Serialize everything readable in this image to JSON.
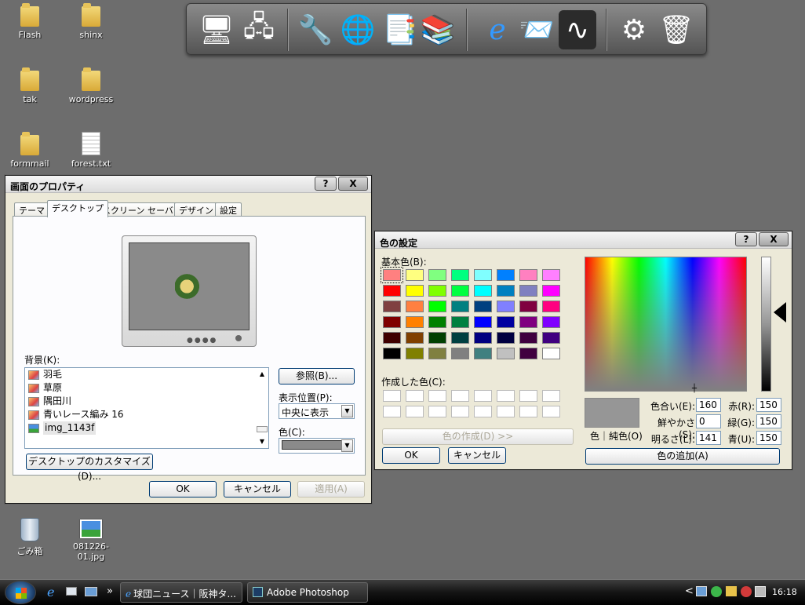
{
  "desktop": {
    "icons": [
      {
        "label": "Flash",
        "icon": "folder-icon"
      },
      {
        "label": "shinx",
        "icon": "folder-icon"
      },
      {
        "label": "tak",
        "icon": "folder-icon"
      },
      {
        "label": "wordpress",
        "icon": "folder-icon"
      },
      {
        "label": "formmail",
        "icon": "folder-icon"
      },
      {
        "label": "forest.txt",
        "icon": "text-file-icon"
      },
      {
        "label": "ごみ箱",
        "icon": "recycle-bin-icon"
      },
      {
        "label": "081226-01.jpg",
        "icon": "image-file-icon"
      }
    ]
  },
  "dock": {
    "items": [
      "network-computer-icon",
      "network-connections-icon",
      "wrench-icon",
      "globe-icon",
      "documents-icon",
      "folders-icon",
      "internet-explorer-icon",
      "mail-icon",
      "sound-wave-icon",
      "gear-icon",
      "recycle-bin-icon"
    ]
  },
  "display_properties": {
    "title": "画面のプロパティ",
    "help_btn": "?",
    "close_btn": "X",
    "tabs": [
      "テーマ",
      "デスクトップ",
      "スクリーン セーバー",
      "デザイン",
      "設定"
    ],
    "active_tab": "デスクトップ",
    "background_label": "背景(K):",
    "background_items": [
      "羽毛",
      "草原",
      "隅田川",
      "青いレース編み 16",
      "img_1143f"
    ],
    "selected_item": "img_1143f",
    "browse_button": "参照(B)...",
    "position_label": "表示位置(P):",
    "position_value": "中央に表示",
    "color_label": "色(C):",
    "color_value": "#8a8a8a",
    "customize_button": "デスクトップのカスタマイズ(D)...",
    "ok_button": "OK",
    "cancel_button": "キャンセル",
    "apply_button": "適用(A)"
  },
  "color_dialog": {
    "title": "色の設定",
    "help_btn": "?",
    "close_btn": "X",
    "basic_colors_label": "基本色(B):",
    "basic_colors": [
      "#ff8080",
      "#ffff80",
      "#80ff80",
      "#00ff80",
      "#80ffff",
      "#0080ff",
      "#ff80c0",
      "#ff80ff",
      "#ff0000",
      "#ffff00",
      "#80ff00",
      "#00ff40",
      "#00ffff",
      "#0080c0",
      "#8080c0",
      "#ff00ff",
      "#804040",
      "#ff8040",
      "#00ff00",
      "#008080",
      "#004080",
      "#8080ff",
      "#800040",
      "#ff0080",
      "#800000",
      "#ff8000",
      "#008000",
      "#008040",
      "#0000ff",
      "#0000a0",
      "#800080",
      "#8000ff",
      "#400000",
      "#804000",
      "#004000",
      "#004040",
      "#000080",
      "#000040",
      "#400040",
      "#400080",
      "#000000",
      "#808000",
      "#808040",
      "#808080",
      "#408080",
      "#c0c0c0",
      "#400040",
      "#ffffff"
    ],
    "selected_basic": "#ff8080",
    "custom_colors_label": "作成した色(C):",
    "define_button": "色の作成(D) >>",
    "ok_button": "OK",
    "cancel_button": "キャンセル",
    "color_solid_label": "色｜純色(O)",
    "hue_label": "色合い(E):",
    "hue": "160",
    "sat_label": "鮮やかさ(S):",
    "sat": "0",
    "lum_label": "明るさ(L):",
    "lum": "141",
    "red_label": "赤(R):",
    "red": "150",
    "green_label": "緑(G):",
    "green": "150",
    "blue_label": "青(U):",
    "blue": "150",
    "current_color": "#969696",
    "add_button": "色の追加(A)"
  },
  "taskbar": {
    "tasks": [
      "球団ニュース｜阪神タ...",
      "Adobe Photoshop"
    ],
    "clock": "16:18",
    "quicklaunch_more": "»",
    "tray_more": "<"
  }
}
